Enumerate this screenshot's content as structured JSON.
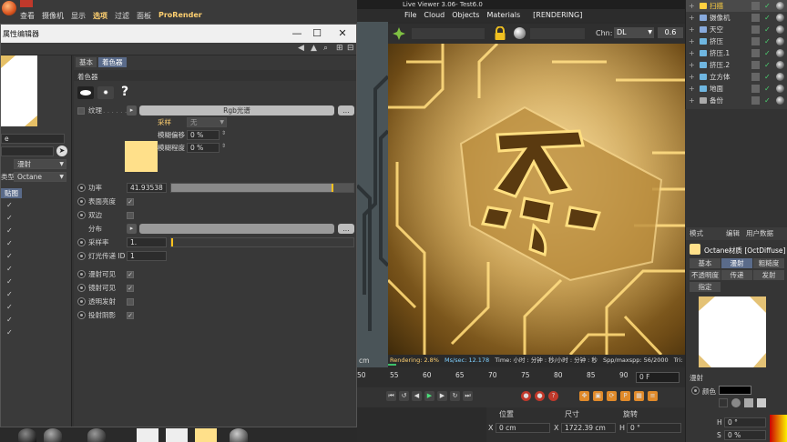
{
  "topbar": {
    "menu": [
      "查看",
      "摄像机",
      "显示",
      "选项",
      "过滤",
      "面板",
      "ProRender"
    ]
  },
  "attr_window": {
    "title": "属性编辑器",
    "tabs": [
      "基本",
      "着色器"
    ],
    "section": "着色器",
    "help_glyph": "?",
    "texture_label": "纹理",
    "texture_shader": "Rgb光谱",
    "more_button": "...",
    "sampling_label": "采样",
    "sampling_value": "无",
    "blur_offset_label": "模糊偏移",
    "blur_offset_value": "0 %",
    "blur_amount_label": "模糊程度",
    "blur_amount_value": "0 %",
    "power_label": "功率",
    "power_value": "41.93538",
    "power_fraction": 0.88,
    "surface_brightness_label": "表面亮度",
    "double_sided_label": "双边",
    "distribution_label": "分布",
    "sample_rate_label": "采样率",
    "sample_rate_value": "1.",
    "light_id_label": "灯光传递 ID",
    "light_id_value": "1",
    "camera_visible_label": "漫射可见",
    "reflect_visible_label": "镜射可见",
    "transparent_emit_label": "透明发射",
    "cast_shadow_label": "投射阴影",
    "left_panel": {
      "field1": "e",
      "dropdown1": "漫射",
      "dropdown2_label": "类型",
      "dropdown2": "Octane",
      "button": "贴图"
    }
  },
  "live_viewer": {
    "title": "Live Viewer 3.06- Test6.0",
    "menu": [
      "File",
      "Cloud",
      "Objects",
      "Materials",
      "[RENDERING]"
    ],
    "chn_label": "Chn:",
    "chn_value": "DL",
    "chn_number": "0.6",
    "status": {
      "rendering": "Rendering: 2.8%",
      "mssec": "Ms/sec: 12.178",
      "time": "Time: 小时 : 分钟 : 秒/小时 : 分钟 : 秒",
      "spp": "Spp/maxspp: 56/2000",
      "tri": "Tri:"
    },
    "render_progress": 0.028,
    "side_unit": "cm"
  },
  "timeline": {
    "ticks": [
      "50",
      "55",
      "60",
      "65",
      "70",
      "75",
      "80",
      "85",
      "90"
    ],
    "frame_field": "0 F"
  },
  "coords": {
    "headers": [
      "位置",
      "尺寸",
      "旋转"
    ],
    "x_label": "X",
    "x_pos": "0 cm",
    "x_size": "1722.39 cm",
    "h_label": "H",
    "h_rot": "0 °"
  },
  "object_manager": {
    "items": [
      {
        "name": "扫描",
        "color": "#ffd040"
      },
      {
        "name": "摄像机",
        "color": "#88aadd"
      },
      {
        "name": "天空",
        "color": "#88aadd"
      },
      {
        "name": "挤压",
        "color": "#6fb6e0"
      },
      {
        "name": "挤压.1",
        "color": "#6fb6e0"
      },
      {
        "name": "挤压.2",
        "color": "#6fb6e0"
      },
      {
        "name": "立方体",
        "color": "#6fb6e0"
      },
      {
        "name": "地面",
        "color": "#6fb6e0"
      },
      {
        "name": "备份",
        "color": "#aaaaaa"
      }
    ]
  },
  "material_panel": {
    "header_tabs": [
      "模式",
      "编辑",
      "用户数据"
    ],
    "material_name": "Octane材质 [OctDiffuse]",
    "tabs_row1": [
      "基本",
      "漫射",
      "粗糙度"
    ],
    "tabs_row2": [
      "不透明度",
      "传递",
      "发射"
    ],
    "tabs_row3": [
      "指定"
    ],
    "section": "漫射",
    "color_label": "颜色",
    "h_label": "H",
    "h_value": "0 °",
    "s_label": "S",
    "s_value": "0 %"
  }
}
